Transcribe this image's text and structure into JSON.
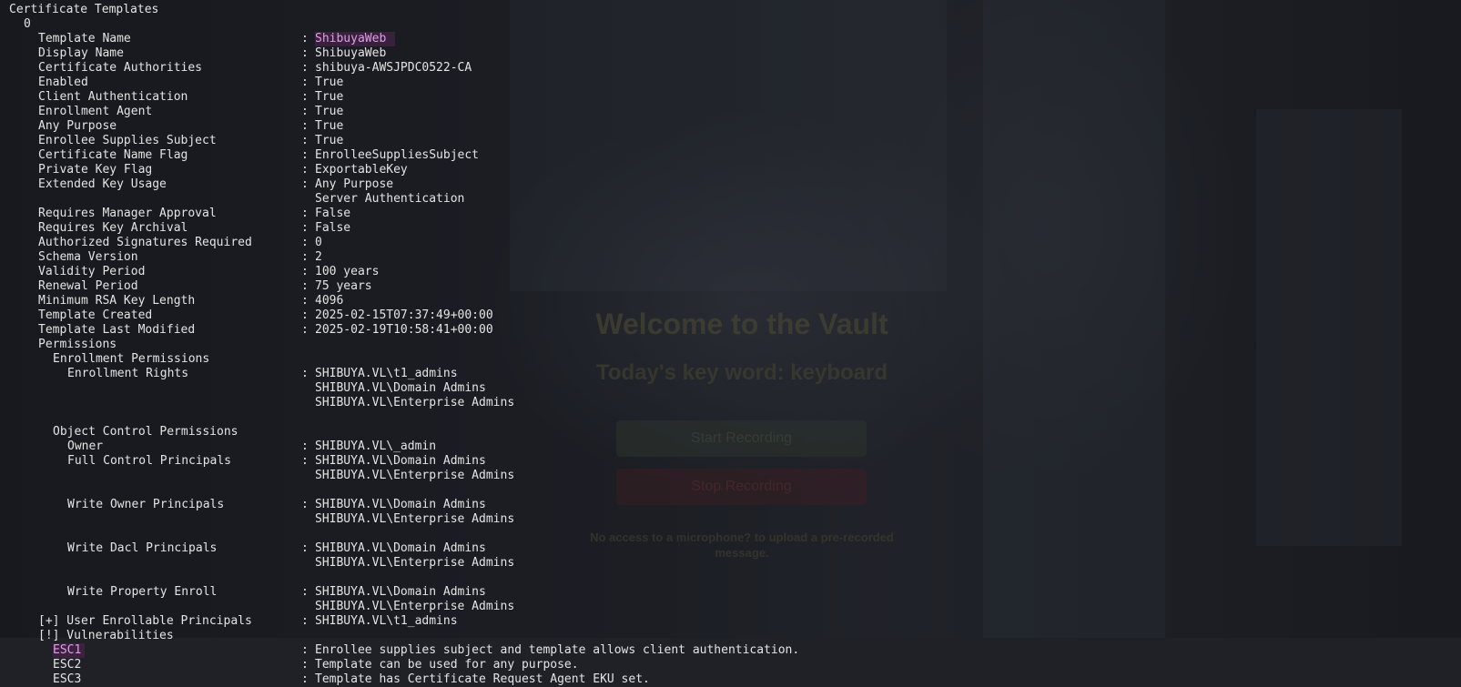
{
  "section_title": "Certificate Templates",
  "index": "0",
  "rows": [
    {
      "key": "Template Name",
      "values": [
        "ShibuyaWeb"
      ]
    },
    {
      "key": "Display Name",
      "values": [
        "ShibuyaWeb"
      ]
    },
    {
      "key": "Certificate Authorities",
      "values": [
        "shibuya-AWSJPDC0522-CA"
      ]
    },
    {
      "key": "Enabled",
      "values": [
        "True"
      ]
    },
    {
      "key": "Client Authentication",
      "values": [
        "True"
      ]
    },
    {
      "key": "Enrollment Agent",
      "values": [
        "True"
      ]
    },
    {
      "key": "Any Purpose",
      "values": [
        "True"
      ]
    },
    {
      "key": "Enrollee Supplies Subject",
      "values": [
        "True"
      ]
    },
    {
      "key": "Certificate Name Flag",
      "values": [
        "EnrolleeSuppliesSubject"
      ]
    },
    {
      "key": "Private Key Flag",
      "values": [
        "ExportableKey"
      ]
    },
    {
      "key": "Extended Key Usage",
      "values": [
        "Any Purpose",
        "Server Authentication"
      ]
    },
    {
      "key": "Requires Manager Approval",
      "values": [
        "False"
      ]
    },
    {
      "key": "Requires Key Archival",
      "values": [
        "False"
      ]
    },
    {
      "key": "Authorized Signatures Required",
      "values": [
        "0"
      ]
    },
    {
      "key": "Schema Version",
      "values": [
        "2"
      ]
    },
    {
      "key": "Validity Period",
      "values": [
        "100 years"
      ]
    },
    {
      "key": "Renewal Period",
      "values": [
        "75 years"
      ]
    },
    {
      "key": "Minimum RSA Key Length",
      "values": [
        "4096"
      ]
    },
    {
      "key": "Template Created",
      "values": [
        "2025-02-15T07:37:49+00:00"
      ]
    },
    {
      "key": "Template Last Modified",
      "values": [
        "2025-02-19T10:58:41+00:00"
      ]
    }
  ],
  "permissions": {
    "title": "Permissions",
    "enrollment_title": "Enrollment Permissions",
    "enrollment_rights": {
      "key": "Enrollment Rights",
      "values": [
        "SHIBUYA.VL\\t1_admins",
        "SHIBUYA.VL\\Domain Admins",
        "SHIBUYA.VL\\Enterprise Admins"
      ]
    },
    "object_control_title": "Object Control Permissions",
    "owner": {
      "key": "Owner",
      "values": [
        "SHIBUYA.VL\\_admin"
      ]
    },
    "full_control": {
      "key": "Full Control Principals",
      "values": [
        "SHIBUYA.VL\\Domain Admins",
        "SHIBUYA.VL\\Enterprise Admins"
      ]
    },
    "write_owner": {
      "key": "Write Owner Principals",
      "values": [
        "SHIBUYA.VL\\Domain Admins",
        "SHIBUYA.VL\\Enterprise Admins"
      ]
    },
    "write_dacl": {
      "key": "Write Dacl Principals",
      "values": [
        "SHIBUYA.VL\\Domain Admins",
        "SHIBUYA.VL\\Enterprise Admins"
      ]
    },
    "write_property": {
      "key": "Write Property Enroll",
      "values": [
        "SHIBUYA.VL\\Domain Admins",
        "SHIBUYA.VL\\Enterprise Admins"
      ]
    }
  },
  "user_enrollable": {
    "key": "[+] User Enrollable Principals",
    "values": [
      "SHIBUYA.VL\\t1_admins"
    ]
  },
  "vulnerabilities": {
    "title": "[!] Vulnerabilities",
    "items": [
      {
        "key": "ESC1",
        "value": "Enrollee supplies subject and template allows client authentication."
      },
      {
        "key": "ESC2",
        "value": "Template can be used for any purpose."
      },
      {
        "key": "ESC3",
        "value": "Template has Certificate Request Agent EKU set."
      }
    ]
  },
  "separator": ":",
  "background": {
    "title": "Welcome to the Vault",
    "subtitle": "Today's key word: keyboard",
    "start_button": "Start Recording",
    "stop_button": "Stop Recording",
    "note_line1": "No access to a microphone?                    to upload a pre-recorded",
    "note_line2": "message."
  },
  "colors": {
    "terminal_text": "#e4e4e4",
    "highlight_text": "#e49be8",
    "highlight_bg": "#522654"
  }
}
